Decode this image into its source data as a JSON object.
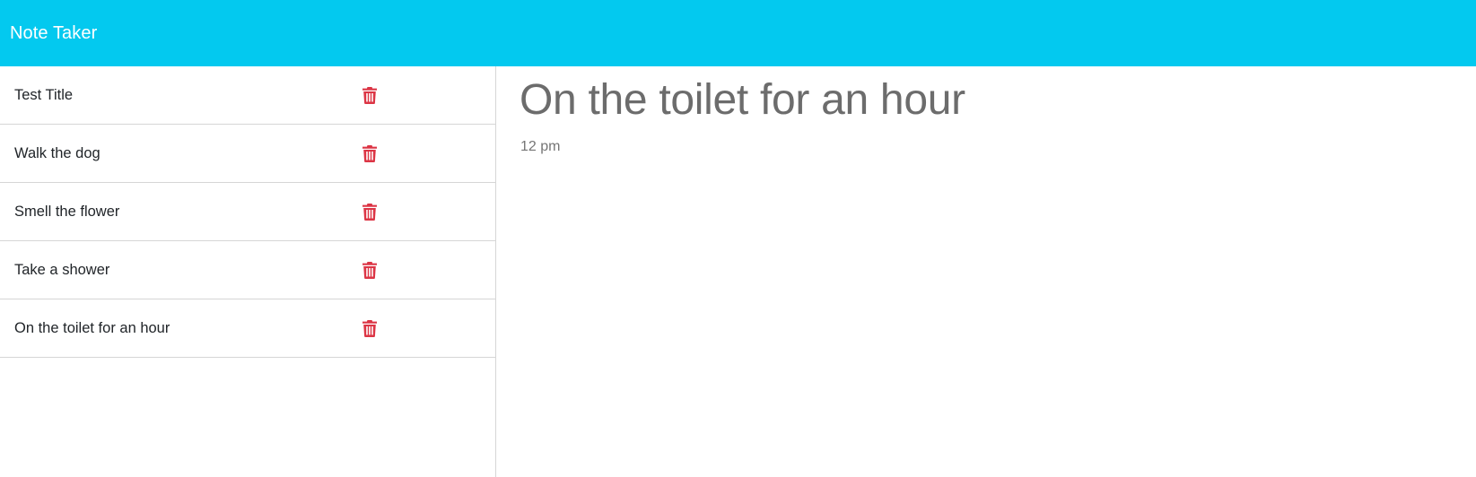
{
  "app": {
    "title": "Note Taker",
    "accent_color": "#03c9ef",
    "delete_color": "#dc3545"
  },
  "notes": [
    {
      "title": "Test Title",
      "icon": "trash-icon"
    },
    {
      "title": "Walk the dog",
      "icon": "trash-icon"
    },
    {
      "title": "Smell the flower",
      "icon": "trash-icon"
    },
    {
      "title": "Take a shower",
      "icon": "trash-icon"
    },
    {
      "title": "On the toilet for an hour",
      "icon": "trash-icon"
    }
  ],
  "active_note": {
    "title": "On the toilet for an hour",
    "text": "12 pm"
  }
}
